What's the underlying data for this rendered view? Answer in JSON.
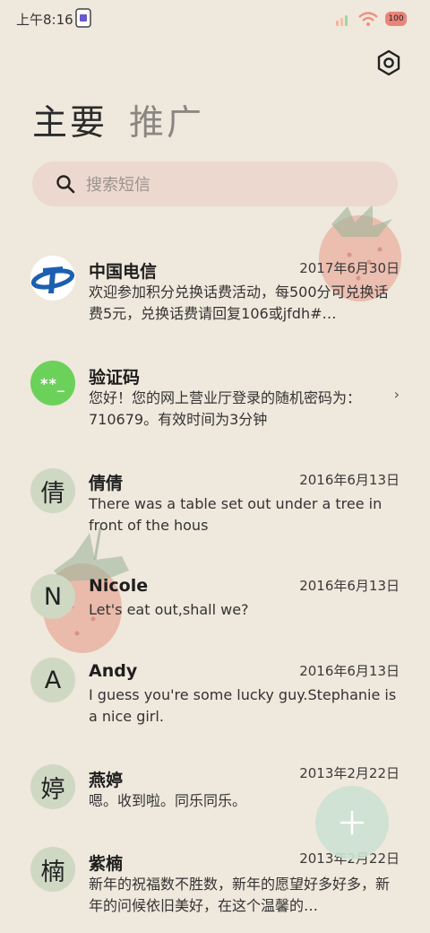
{
  "status_bar": {
    "time": "上午8:16",
    "battery": "100"
  },
  "tabs": [
    {
      "label": "主要",
      "active": true
    },
    {
      "label": "推广",
      "active": false
    }
  ],
  "search": {
    "placeholder": "搜索短信"
  },
  "conversations": [
    {
      "avatar": "",
      "name": "中国电信",
      "date": "2017年6月30日",
      "preview": "欢迎参加积分兑换话费活动，每500分可兑换话费5元，兑换话费请回复106或jfdh#…"
    },
    {
      "avatar": "**_",
      "name": "验证码",
      "date": "",
      "preview": "您好！您的网上营业厅登录的随机密码为：710679。有效时间为3分钟"
    },
    {
      "avatar": "倩",
      "name": "倩倩",
      "date": "2016年6月13日",
      "preview": "There was a table set out under a tree in front of the hous"
    },
    {
      "avatar": "N",
      "name": "Nicole",
      "date": "2016年6月13日",
      "preview": "Let's eat out,shall we?"
    },
    {
      "avatar": "A",
      "name": "Andy",
      "date": "2016年6月13日",
      "preview": "I guess you're some lucky guy.Stephanie is a nice girl."
    },
    {
      "avatar": "婷",
      "name": "燕婷",
      "date": "2013年2月22日",
      "preview": "嗯。收到啦。同乐同乐。"
    },
    {
      "avatar": "楠",
      "name": "紫楠",
      "date": "2013年2月22日",
      "preview": "新年的祝福数不胜数，新年的愿望好多好多，新年的问候依旧美好，在这个温馨的…"
    }
  ],
  "colors": {
    "background": "#efe8dc",
    "search_bg": "#ecd8cf",
    "avatar_bg": "#cfd8c3",
    "verify_avatar": "#6bd15a",
    "telecom_blue": "#1c5fb0",
    "fab_bg": "#cce1d1"
  },
  "icons": {
    "settings": "hexagon-settings-icon",
    "search": "search-icon",
    "fab": "plus-icon",
    "chevron": "chevron-right-icon"
  }
}
